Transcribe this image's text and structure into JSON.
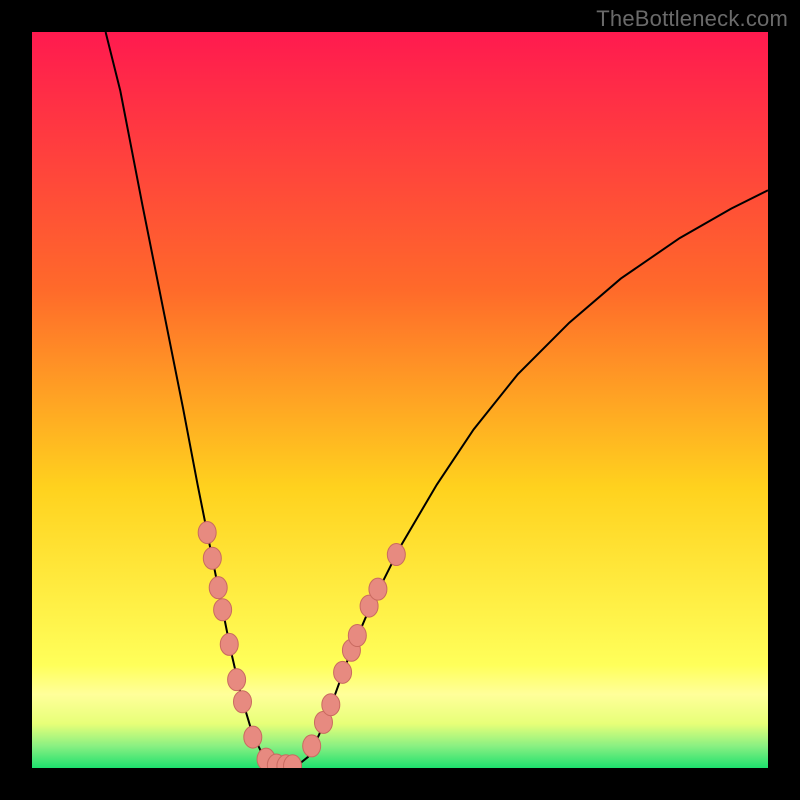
{
  "watermark": "TheBottleneck.com",
  "colors": {
    "gradient_top": "#ff1a4f",
    "gradient_mid1": "#ff6a2a",
    "gradient_mid2": "#ffd21e",
    "gradient_band": "#ffff9a",
    "gradient_bottom": "#1ee06e",
    "curve": "#000000",
    "marker_fill": "#e78a80",
    "marker_stroke": "#c96a60",
    "frame": "#000000"
  },
  "chart_data": {
    "type": "line",
    "title": "",
    "xlabel": "",
    "ylabel": "",
    "xlim": [
      0,
      100
    ],
    "ylim": [
      0,
      100
    ],
    "curve_left": {
      "description": "steep descending left branch",
      "points": [
        {
          "x": 10.0,
          "y": 100.0
        },
        {
          "x": 12.0,
          "y": 92.0
        },
        {
          "x": 15.0,
          "y": 76.5
        },
        {
          "x": 18.0,
          "y": 61.5
        },
        {
          "x": 20.5,
          "y": 49.0
        },
        {
          "x": 22.5,
          "y": 38.5
        },
        {
          "x": 24.0,
          "y": 31.0
        },
        {
          "x": 25.5,
          "y": 23.5
        },
        {
          "x": 27.0,
          "y": 16.0
        },
        {
          "x": 28.5,
          "y": 9.5
        },
        {
          "x": 30.0,
          "y": 4.5
        },
        {
          "x": 31.5,
          "y": 1.5
        },
        {
          "x": 33.0,
          "y": 0.3
        }
      ]
    },
    "curve_right": {
      "description": "ascending right branch, concave down",
      "points": [
        {
          "x": 36.0,
          "y": 0.3
        },
        {
          "x": 37.5,
          "y": 1.5
        },
        {
          "x": 39.0,
          "y": 4.5
        },
        {
          "x": 41.0,
          "y": 9.5
        },
        {
          "x": 43.0,
          "y": 15.0
        },
        {
          "x": 46.0,
          "y": 22.0
        },
        {
          "x": 50.0,
          "y": 30.0
        },
        {
          "x": 55.0,
          "y": 38.5
        },
        {
          "x": 60.0,
          "y": 46.0
        },
        {
          "x": 66.0,
          "y": 53.5
        },
        {
          "x": 73.0,
          "y": 60.5
        },
        {
          "x": 80.0,
          "y": 66.5
        },
        {
          "x": 88.0,
          "y": 72.0
        },
        {
          "x": 95.0,
          "y": 76.0
        },
        {
          "x": 100.0,
          "y": 78.5
        }
      ]
    },
    "markers_left": [
      {
        "x": 23.8,
        "y": 32.0
      },
      {
        "x": 24.5,
        "y": 28.5
      },
      {
        "x": 25.3,
        "y": 24.5
      },
      {
        "x": 25.9,
        "y": 21.5
      },
      {
        "x": 26.8,
        "y": 16.8
      },
      {
        "x": 27.8,
        "y": 12.0
      },
      {
        "x": 28.6,
        "y": 9.0
      },
      {
        "x": 30.0,
        "y": 4.2
      },
      {
        "x": 31.8,
        "y": 1.2
      },
      {
        "x": 33.2,
        "y": 0.4
      },
      {
        "x": 34.5,
        "y": 0.3
      },
      {
        "x": 35.4,
        "y": 0.3
      }
    ],
    "markers_right": [
      {
        "x": 38.0,
        "y": 3.0
      },
      {
        "x": 39.6,
        "y": 6.2
      },
      {
        "x": 40.6,
        "y": 8.6
      },
      {
        "x": 42.2,
        "y": 13.0
      },
      {
        "x": 43.4,
        "y": 16.0
      },
      {
        "x": 44.2,
        "y": 18.0
      },
      {
        "x": 45.8,
        "y": 22.0
      },
      {
        "x": 47.0,
        "y": 24.3
      },
      {
        "x": 49.5,
        "y": 29.0
      }
    ]
  }
}
